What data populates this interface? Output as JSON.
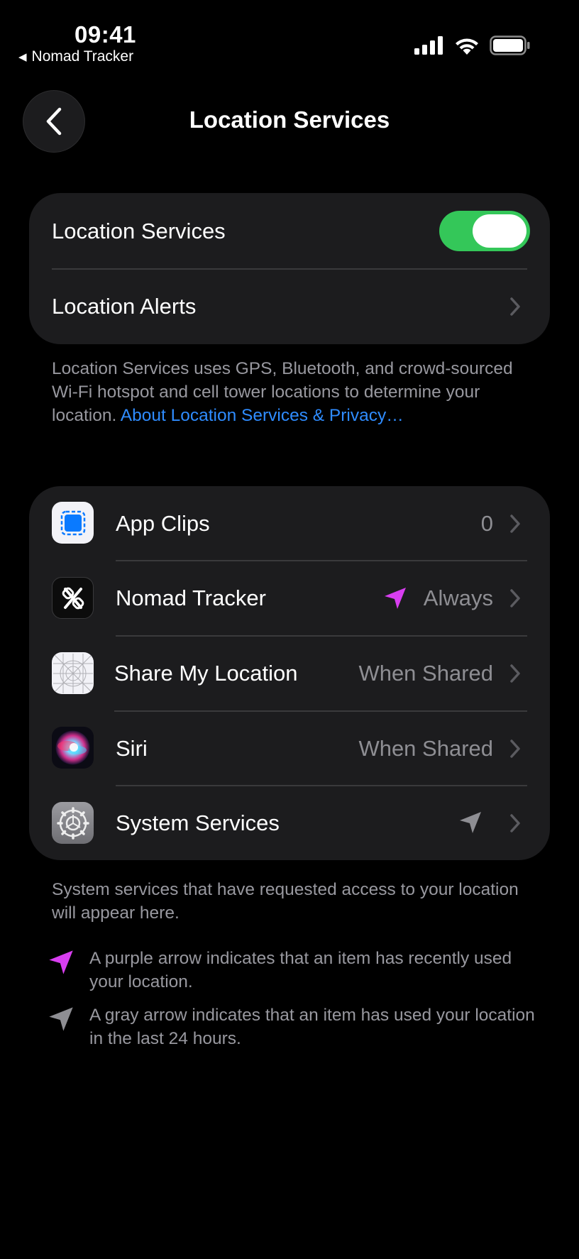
{
  "status_bar": {
    "time": "09:41",
    "back_app": "Nomad Tracker",
    "icons": [
      "cellular-signal-icon",
      "wifi-icon",
      "battery-icon"
    ]
  },
  "nav": {
    "title": "Location Services"
  },
  "main_section": {
    "location_services_label": "Location Services",
    "location_services_enabled": true,
    "location_alerts_label": "Location Alerts"
  },
  "description": {
    "text": "Location Services uses GPS, Bluetooth, and crowd-sourced Wi-Fi hotspot and cell tower locations to determine your location.",
    "link": "About Location Services & Privacy…"
  },
  "apps": [
    {
      "label": "App Clips",
      "value": "0",
      "icon": "app-clips-icon",
      "arrow": ""
    },
    {
      "label": "Nomad Tracker",
      "value": "Always",
      "icon": "nomad-tracker-icon",
      "arrow": "purple"
    },
    {
      "label": "Share My Location",
      "value": "When Shared",
      "icon": "share-my-location-icon",
      "arrow": ""
    },
    {
      "label": "Siri",
      "value": "When Shared",
      "icon": "siri-icon",
      "arrow": ""
    },
    {
      "label": "System Services",
      "value": "",
      "icon": "system-services-icon",
      "arrow": "gray"
    }
  ],
  "footer": {
    "system_note": "System services that have requested access to your location will appear here.",
    "purple_legend": "A purple arrow indicates that an item has recently used your location.",
    "gray_legend": "A gray arrow indicates that an item has used your location in the last 24 hours."
  },
  "colors": {
    "background": "#000000",
    "card": "#1c1c1e",
    "toggle_on": "#34c759",
    "link": "#2f8cff",
    "purple_arrow": "#d83ef0",
    "gray_arrow": "#8e8e93",
    "secondary_text": "#98989f"
  }
}
